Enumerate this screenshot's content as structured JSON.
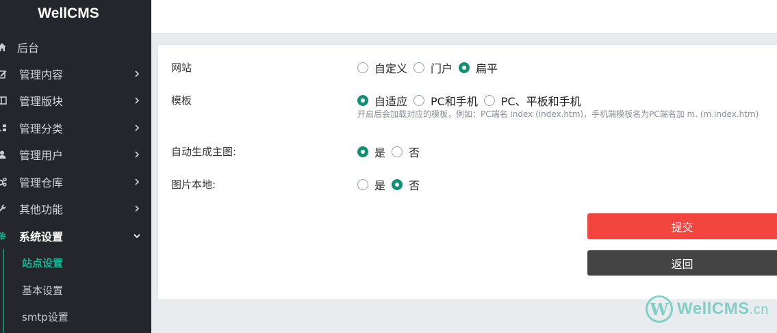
{
  "app": {
    "brand": "WellCMS"
  },
  "sidebar": {
    "items": [
      {
        "label": "后台",
        "icon": "home-icon"
      },
      {
        "label": "管理内容",
        "icon": "edit-icon"
      },
      {
        "label": "管理版块",
        "icon": "columns-icon"
      },
      {
        "label": "管理分类",
        "icon": "sort-icon"
      },
      {
        "label": "管理用户",
        "icon": "user-icon"
      },
      {
        "label": "管理仓库",
        "icon": "cogs-icon"
      },
      {
        "label": "其他功能",
        "icon": "wrench-icon"
      },
      {
        "label": "系统设置",
        "icon": "gear-icon"
      }
    ],
    "sub_items": [
      {
        "label": "站点设置"
      },
      {
        "label": "基本设置"
      },
      {
        "label": "smtp设置"
      }
    ]
  },
  "form": {
    "website": {
      "label": "网站",
      "options": [
        "自定义",
        "门户",
        "扁平"
      ],
      "selected": "扁平"
    },
    "template": {
      "label": "模板",
      "options": [
        "自适应",
        "PC和手机",
        "PC、平板和手机"
      ],
      "selected": "自适应",
      "hint": "开启后会加载对应的模板，例如：PC端名 index (index.htm)，手机端模板名为PC端名加 m. (m.index.htm)"
    },
    "auto_thumbnail": {
      "label": "自动生成主图:",
      "options": [
        "是",
        "否"
      ],
      "selected": "是"
    },
    "local_images": {
      "label": "图片本地:",
      "options": [
        "是",
        "否"
      ],
      "selected": "否"
    },
    "submit_label": "提交",
    "back_label": "返回"
  },
  "watermark": {
    "text": "WellCMS",
    "suffix": ".cn"
  },
  "colors": {
    "sidebar_bg": "#24262b",
    "accent": "#119172",
    "submit": "#f2453d",
    "back": "#444444"
  }
}
